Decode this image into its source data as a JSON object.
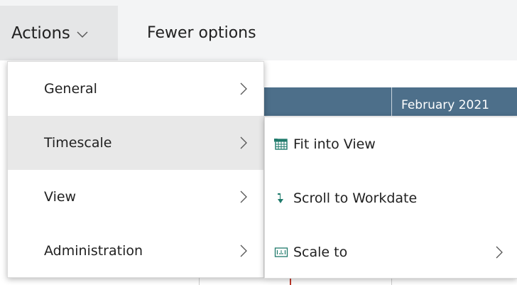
{
  "toolbar": {
    "actions_label": "Actions",
    "fewer_options_label": "Fewer options"
  },
  "timeline": {
    "month_label": "February 2021"
  },
  "menu": {
    "items": [
      {
        "label": "General",
        "active": false
      },
      {
        "label": "Timescale",
        "active": true
      },
      {
        "label": "View",
        "active": false
      },
      {
        "label": "Administration",
        "active": false
      }
    ]
  },
  "submenu": {
    "items": [
      {
        "label": "Fit into View",
        "icon": "fit-into-view-icon"
      },
      {
        "label": "Scroll to Workdate",
        "icon": "scroll-down-arrow-icon"
      },
      {
        "label": "Scale to",
        "icon": "scale-icon",
        "has_submenu": true
      }
    ]
  },
  "colors": {
    "toolbar_bg": "#f3f4f5",
    "active_button_bg": "#e5e6e7",
    "timeline_header_bg": "#4d6f8a",
    "menu_active_bg": "#e8e8e8",
    "icon_teal": "#1f7a6b"
  }
}
